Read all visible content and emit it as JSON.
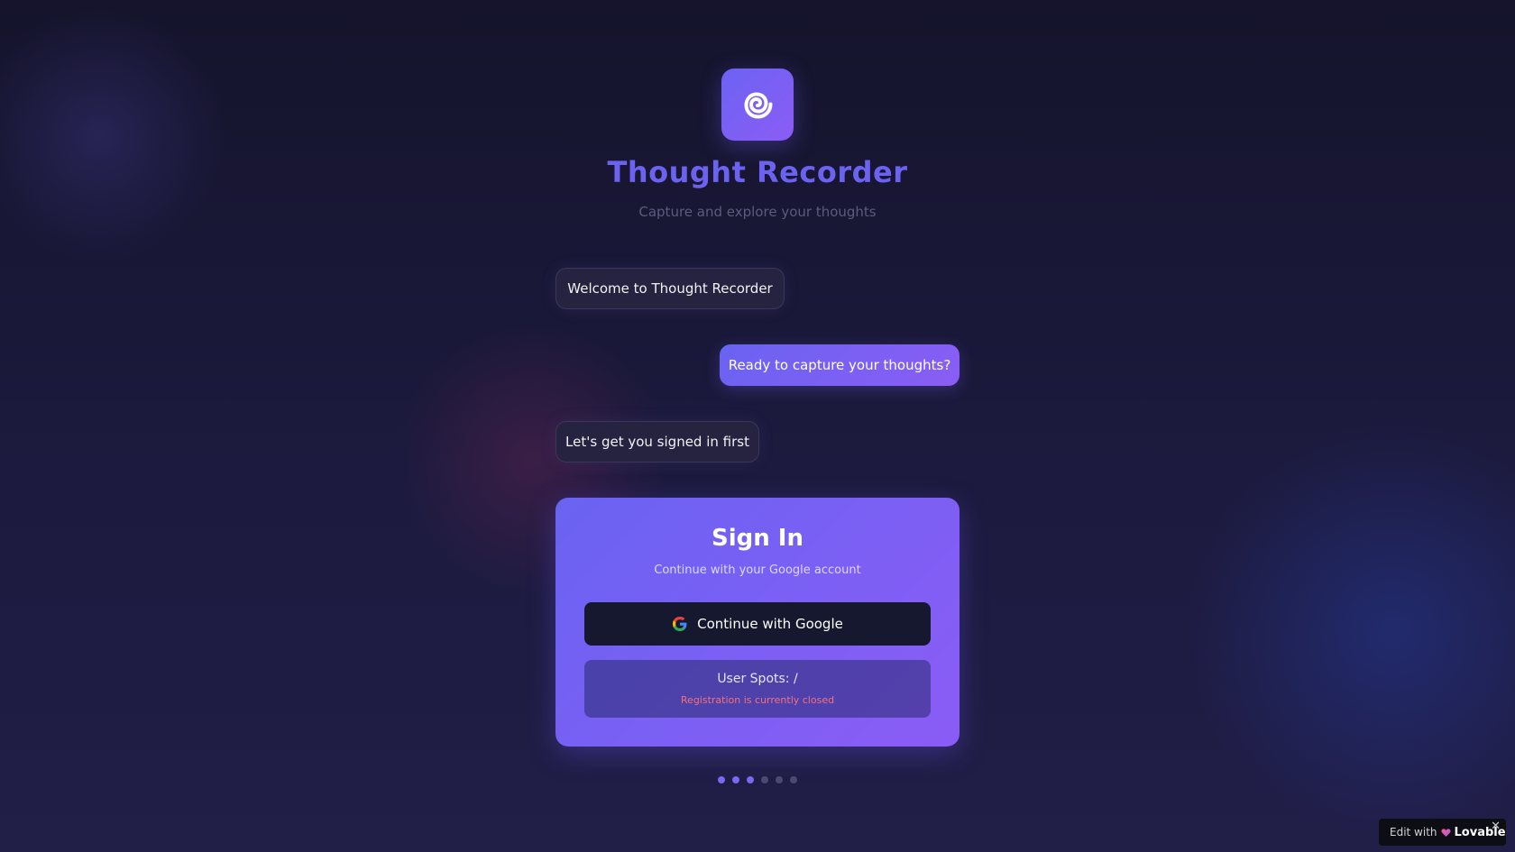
{
  "app": {
    "title": "Thought Recorder",
    "subtitle": "Capture and explore your thoughts",
    "logo_icon": "spiral-icon"
  },
  "chat": {
    "messages": [
      {
        "role": "bot",
        "text": "Welcome to Thought Recorder"
      },
      {
        "role": "user",
        "text": "Ready to capture your thoughts?"
      },
      {
        "role": "bot",
        "text": "Let's get you signed in first"
      }
    ]
  },
  "signin": {
    "title": "Sign In",
    "subtitle": "Continue with your Google account",
    "google_button_label": "Continue with Google",
    "google_icon": "google-icon",
    "user_spots_label": "User Spots: /",
    "registration_status": "Registration is currently closed"
  },
  "progress": {
    "total_steps": 6,
    "active_steps": 3
  },
  "badge": {
    "edit_text": "Edit with",
    "brand": "Lovable",
    "close_icon": "close-icon"
  },
  "colors": {
    "accent": "#6b62f0",
    "accent_end": "#8b5cf6",
    "background": "#1a1836",
    "error": "#f2707a"
  }
}
